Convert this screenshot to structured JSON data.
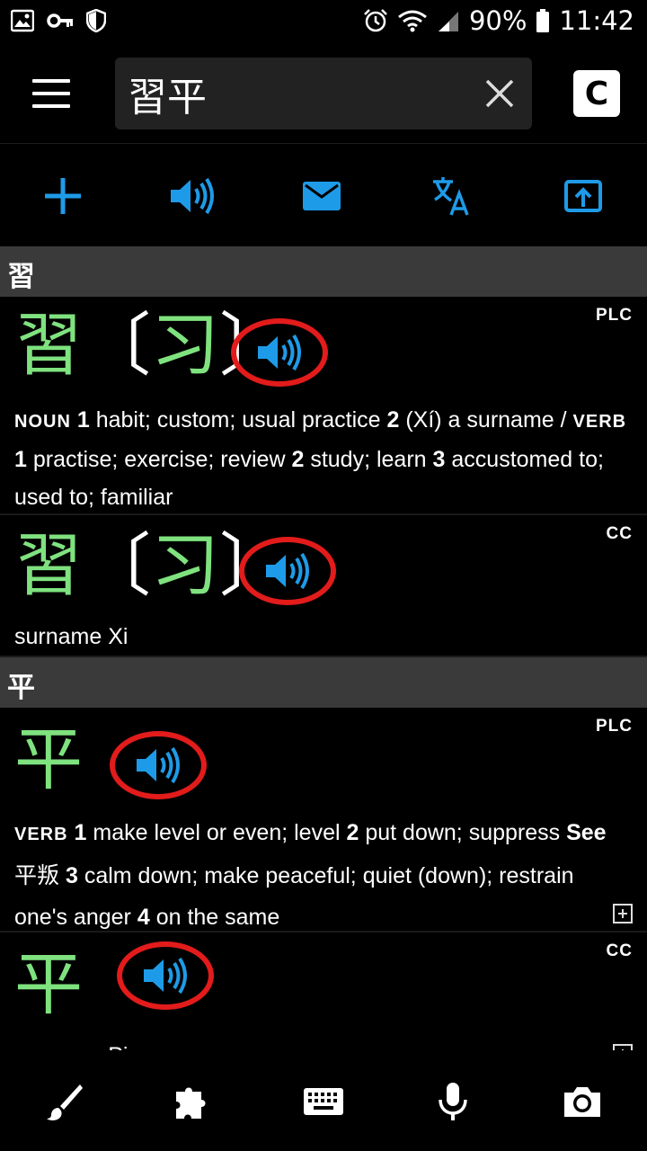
{
  "status_bar": {
    "battery": "90%",
    "time": "11:42"
  },
  "search": {
    "value": "習平"
  },
  "appbar": {
    "c_button_label": "C"
  },
  "sections": [
    {
      "header": "習",
      "entries": [
        {
          "source": "PLC",
          "headword": "習",
          "simplified": "习",
          "definition_parts": {
            "noun_label": "NOUN",
            "n1": "1",
            "t1": "habit; custom; usual practice",
            "n2": "2",
            "t2": "(Xí) a surname",
            "sep": "/",
            "verb_label": "VERB",
            "v1": "1",
            "vt1": "practise; exercise; review",
            "v2": "2",
            "vt2": "study; learn",
            "v3": "3",
            "vt3": "accustomed to; used to; familiar"
          }
        },
        {
          "source": "CC",
          "headword": "習",
          "simplified": "习",
          "definition": "surname Xi"
        }
      ]
    },
    {
      "header": "平",
      "entries": [
        {
          "source": "PLC",
          "headword": "平",
          "definition_parts": {
            "verb_label": "VERB",
            "n1": "1",
            "t1": "make level or even; level",
            "n2": "2",
            "t2": "put down; suppress",
            "see_label": "See",
            "see_word": "平叛",
            "n3": "3",
            "t3": "calm down; make peaceful; quiet (down); restrain one's anger",
            "n4": "4",
            "t4": "on the same"
          }
        },
        {
          "source": "CC",
          "headword": "平",
          "definition": "surname Ping"
        }
      ]
    }
  ],
  "colors": {
    "accent_blue": "#1e9be8",
    "headword_green": "#7fe27f",
    "highlight_red": "#e21b1b",
    "section_header_bg": "#3a3a3a"
  },
  "icons": {
    "action_row": [
      "add-icon",
      "speaker-icon",
      "mail-icon",
      "translate-icon",
      "share-icon"
    ],
    "bottom_bar": [
      "brush-icon",
      "puzzle-icon",
      "keyboard-icon",
      "microphone-icon",
      "camera-icon"
    ]
  }
}
